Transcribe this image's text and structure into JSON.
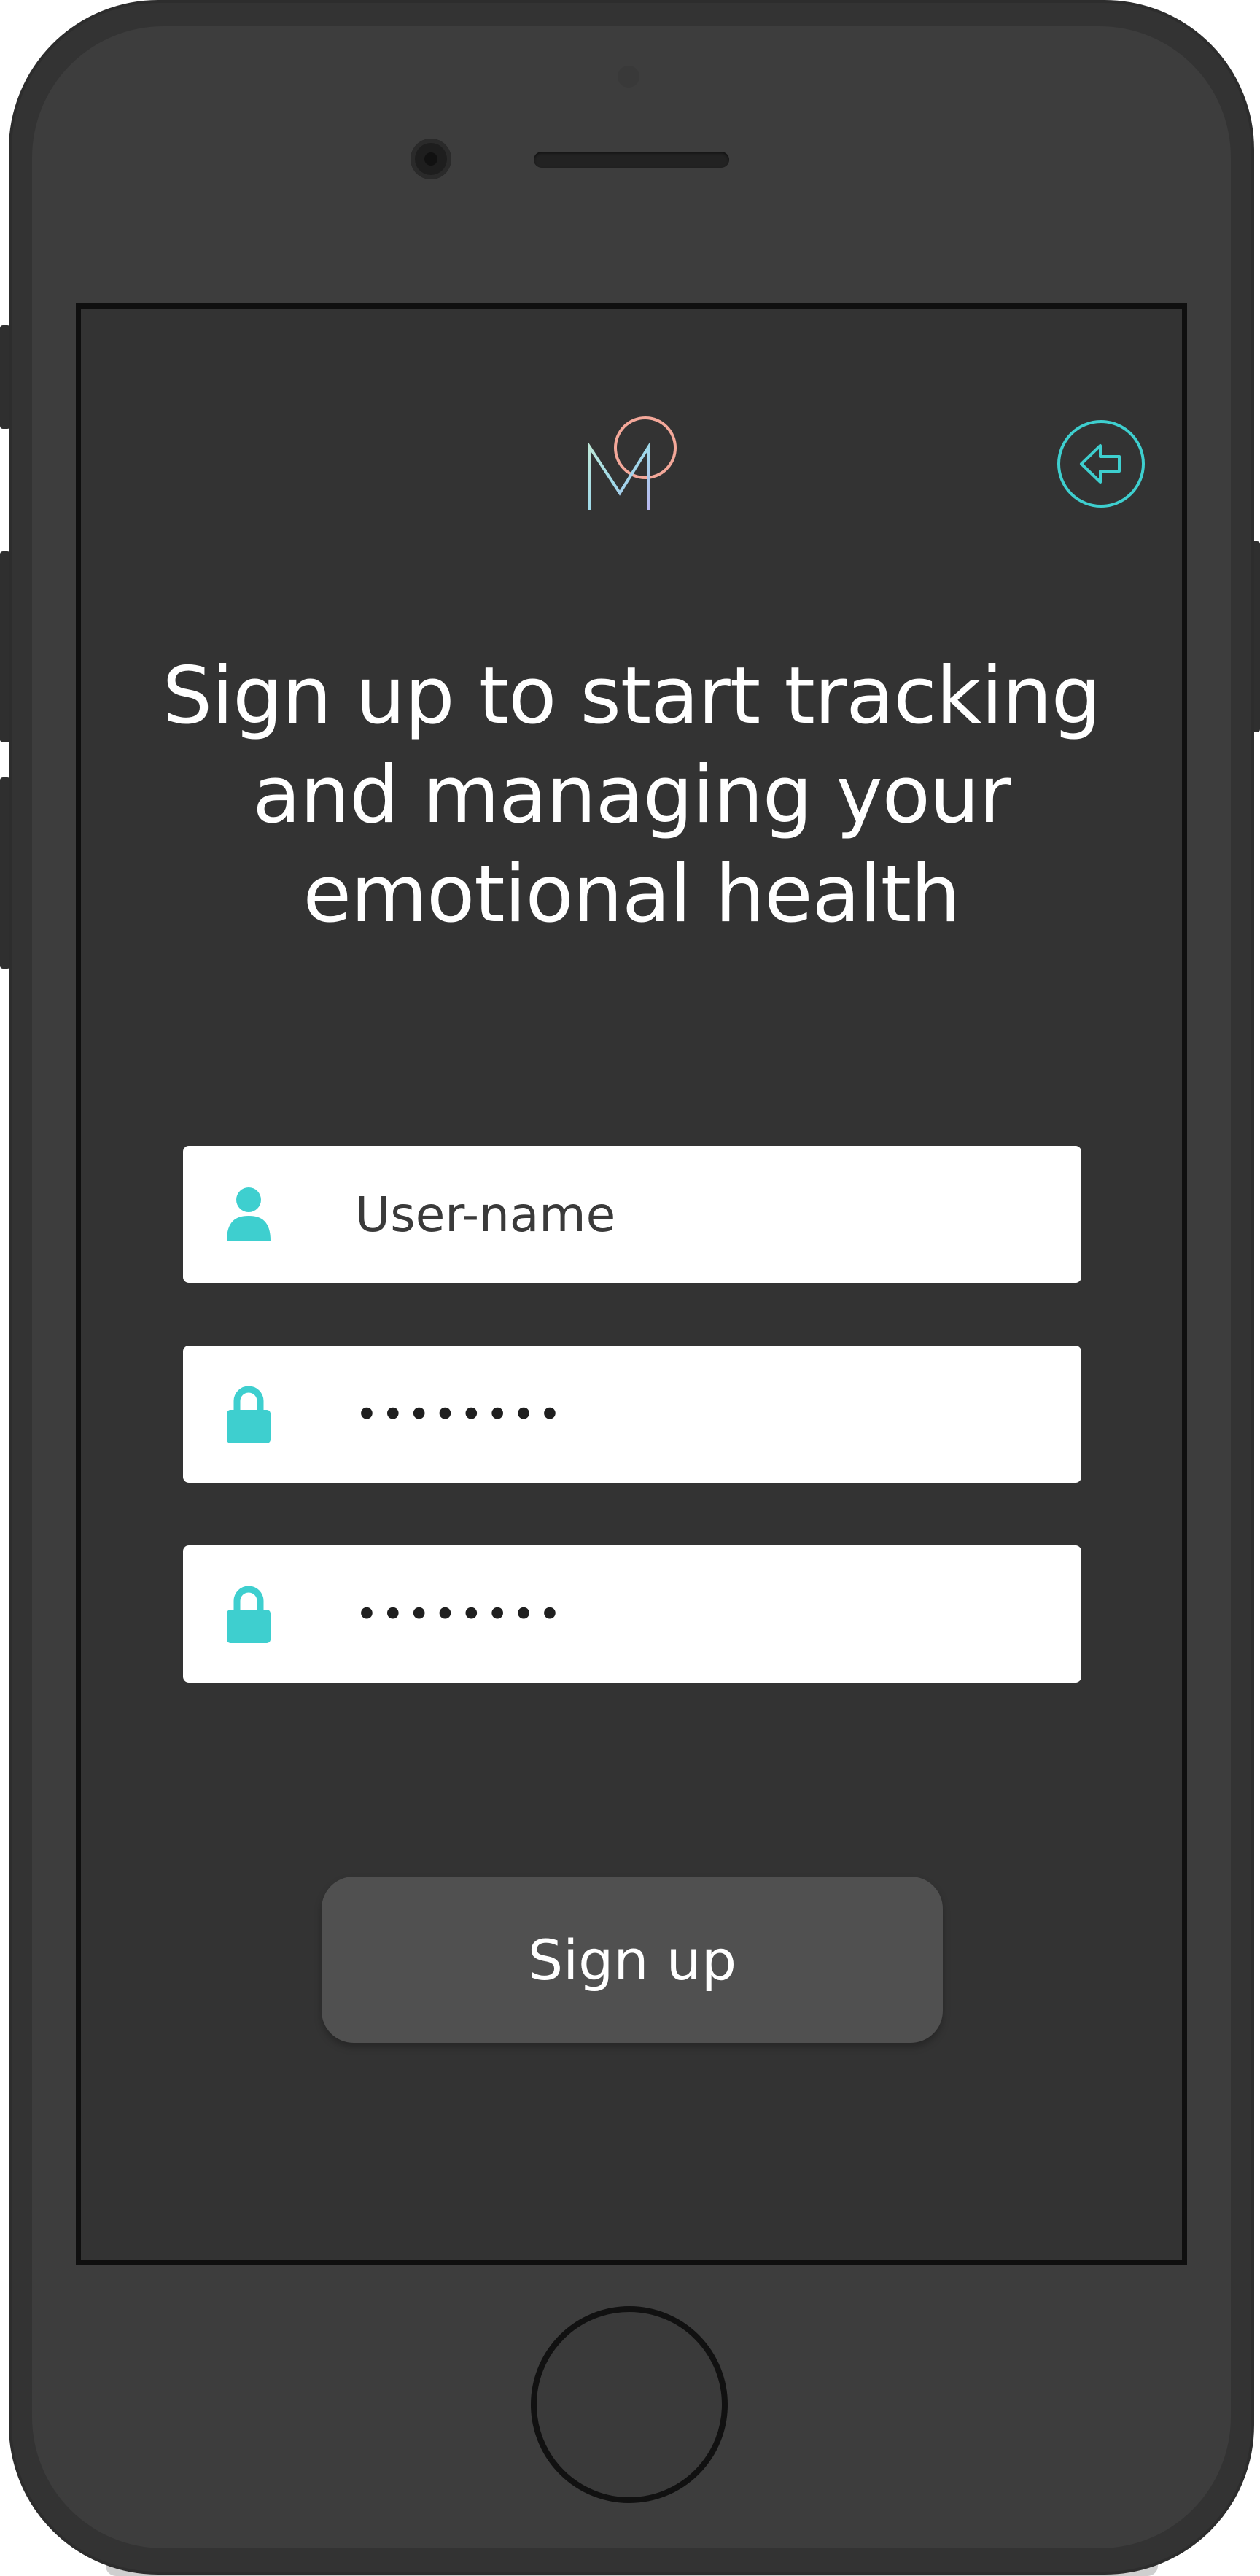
{
  "colors": {
    "accent": "#3ecfcf",
    "screen_background": "#333333",
    "button_background": "#505050",
    "logo_circle": "#f4a89a"
  },
  "icons": {
    "back": "arrow-left-circle-icon",
    "username": "user-icon",
    "password": "lock-icon",
    "logo": "mood-logo"
  },
  "header": {
    "headline": "Sign up to start tracking\nand managing your\nemotional health"
  },
  "form": {
    "username": {
      "placeholder": "User-name",
      "value": ""
    },
    "password": {
      "value": "••••••••"
    },
    "confirm_password": {
      "value": "••••••••"
    },
    "submit_label": "Sign up"
  }
}
